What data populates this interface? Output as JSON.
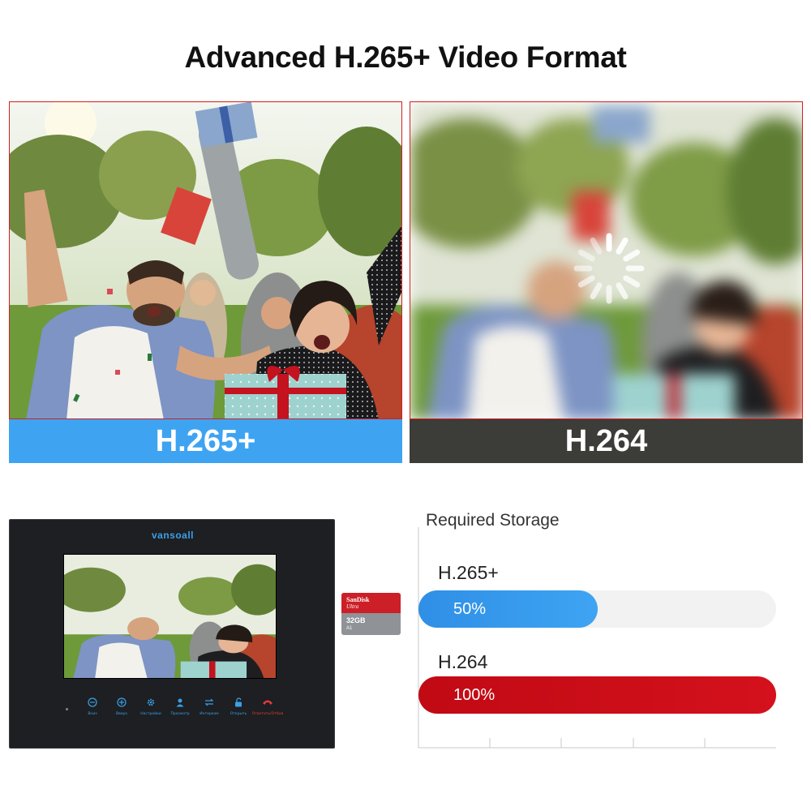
{
  "title": "Advanced H.265+ Video Format",
  "panels": {
    "left_label": "H.265+",
    "right_label": "H.264"
  },
  "colors": {
    "h265_band": "#3ea4f2",
    "h264_band": "#3c3c38",
    "h265_bar": "#3ea4f2",
    "h264_bar": "#d4111c"
  },
  "monitor": {
    "brand": "vansoall",
    "buttons": [
      {
        "icon": "minus-circle-icon",
        "label": "Вниз"
      },
      {
        "icon": "plus-circle-icon",
        "label": "Вверх"
      },
      {
        "icon": "gear-icon",
        "label": "Настройки"
      },
      {
        "icon": "person-icon",
        "label": "Просмотр"
      },
      {
        "icon": "transfer-icon",
        "label": "Интерком"
      },
      {
        "icon": "unlock-icon",
        "label": "Открыть"
      },
      {
        "icon": "phone-icon",
        "label": "Ответить/Отбой"
      }
    ]
  },
  "sdcard": {
    "brand": "SanDisk",
    "line": "Ultra",
    "capacity": "32GB",
    "marks": "A1"
  },
  "chart_data": {
    "type": "bar",
    "title": "Required Storage",
    "categories": [
      "H.265+",
      "H.264"
    ],
    "values": [
      50,
      100
    ],
    "value_labels": [
      "50%",
      "100%"
    ],
    "xlim": [
      0,
      100
    ],
    "orientation": "horizontal"
  }
}
